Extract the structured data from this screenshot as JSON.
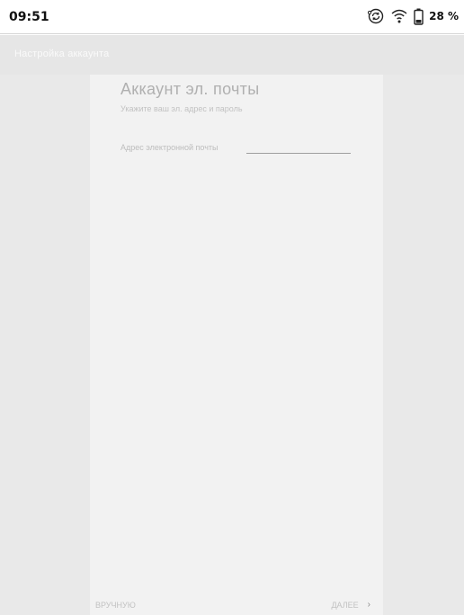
{
  "status_bar": {
    "time": "09:51",
    "battery": "28 %",
    "icons": [
      "sync-icon",
      "wifi-icon",
      "battery-icon"
    ]
  },
  "title_bar": {
    "title": "Настройка аккаунта"
  },
  "form": {
    "title": "Аккаунт эл. почты",
    "subtitle": "Укажите ваш эл. адрес и пароль",
    "email_label": "Адрес электронной почты",
    "email_value": "",
    "email_placeholder": ""
  },
  "footer": {
    "manual_label": "ВРУЧНУЮ",
    "next_label": "ДАЛЕЕ",
    "next_icon": "chevron-right-icon"
  }
}
